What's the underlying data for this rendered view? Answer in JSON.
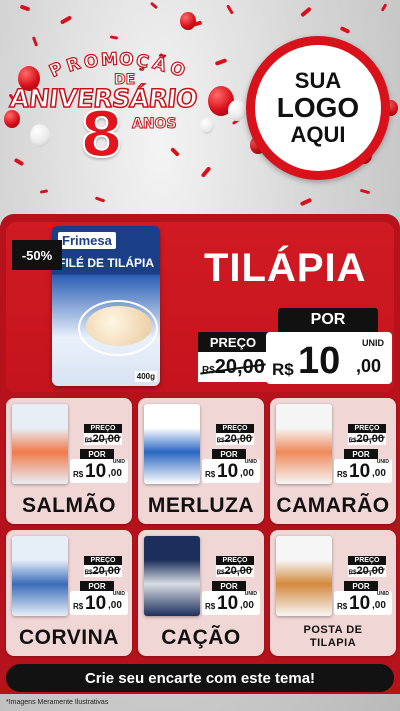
{
  "header": {
    "promo": [
      "P",
      "R",
      "O",
      "M",
      "O",
      "Ç",
      "Ã",
      "O"
    ],
    "de": "DE",
    "aniversario": "ANIVERSÁRIO",
    "number": "8",
    "anos": "ANOS",
    "logo_lines": [
      "SUA",
      "LOGO",
      "AQUI"
    ]
  },
  "hero": {
    "discount": "-50%",
    "brand": "Frimesa",
    "pack_name": "FILÉ DE TILÁPIA",
    "pack_weight": "400g",
    "title": "TILÁPIA",
    "preco_label": "PREÇO",
    "old_currency": "R$",
    "old_price": "20,00",
    "por_label": "POR",
    "unid": "UNID",
    "currency": "R$",
    "price_int": "10",
    "price_cents": ",00"
  },
  "products": [
    {
      "name": "SALMÃO",
      "preco_label": "PREÇO",
      "old_currency": "R$",
      "old_price": "20,00",
      "por_label": "POR",
      "currency": "R$",
      "price_int": "10",
      "price_cents": ",00",
      "unid": "UNID",
      "pack_colors": [
        "#e8eef6",
        "#f07a4a"
      ]
    },
    {
      "name": "MERLUZA",
      "preco_label": "PREÇO",
      "old_currency": "R$",
      "old_price": "20,00",
      "por_label": "POR",
      "currency": "R$",
      "price_int": "10",
      "price_cents": ",00",
      "unid": "UNID",
      "pack_colors": [
        "#ffffff",
        "#2a67c2"
      ],
      "brand": "Copacol"
    },
    {
      "name": "CAMARÃO",
      "preco_label": "PREÇO",
      "old_currency": "R$",
      "old_price": "20,00",
      "por_label": "POR",
      "currency": "R$",
      "price_int": "10",
      "price_cents": ",00",
      "unid": "UNID",
      "pack_colors": [
        "#f5f5f5",
        "#f08a5a"
      ]
    },
    {
      "name": "CORVINA",
      "preco_label": "PREÇO",
      "old_currency": "R$",
      "old_price": "20,00",
      "por_label": "POR",
      "currency": "R$",
      "price_int": "10",
      "price_cents": ",00",
      "unid": "UNID",
      "pack_colors": [
        "#e6eef8",
        "#3a6cb8"
      ]
    },
    {
      "name": "CAÇÃO",
      "preco_label": "PREÇO",
      "old_currency": "R$",
      "old_price": "20,00",
      "por_label": "POR",
      "currency": "R$",
      "price_int": "10",
      "price_cents": ",00",
      "unid": "UNID",
      "pack_colors": [
        "#1c2f5c",
        "#d9dde4"
      ]
    },
    {
      "name": "POSTA DE TILAPIA",
      "preco_label": "PREÇO",
      "old_currency": "R$",
      "old_price": "20,00",
      "por_label": "POR",
      "currency": "R$",
      "price_int": "10",
      "price_cents": ",00",
      "unid": "UNID",
      "pack_colors": [
        "#f6f6f6",
        "#d38a3c"
      ],
      "brand": "Copacol"
    }
  ],
  "cta": "Crie seu encarte com este tema!",
  "footnote": "*Imagens Meramente Ilustrativas",
  "colors": {
    "brand_red": "#d11a23",
    "dark_red": "#b5121b",
    "black": "#111111",
    "card_pink": "#f1d6d6"
  }
}
